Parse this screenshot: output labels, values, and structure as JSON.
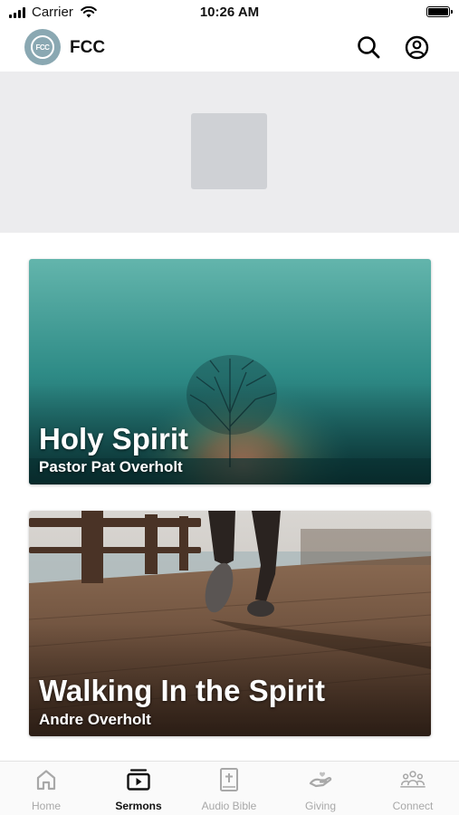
{
  "status_bar": {
    "carrier": "Carrier",
    "time": "10:26 AM"
  },
  "header": {
    "logo_text": "FCC",
    "title": "FCC",
    "icons": [
      "search-icon",
      "profile-icon"
    ]
  },
  "sermons": [
    {
      "title": "Holy Spirit",
      "speaker": "Pastor Pat Overholt"
    },
    {
      "title": "Walking In the Spirit",
      "speaker": "Andre Overholt"
    }
  ],
  "tabs": [
    {
      "label": "Home",
      "icon": "home-icon",
      "active": false
    },
    {
      "label": "Sermons",
      "icon": "sermons-icon",
      "active": true
    },
    {
      "label": "Audio Bible",
      "icon": "bible-icon",
      "active": false
    },
    {
      "label": "Giving",
      "icon": "giving-icon",
      "active": false
    },
    {
      "label": "Connect",
      "icon": "connect-icon",
      "active": false
    }
  ],
  "colors": {
    "accent": "#111111",
    "inactive_tab": "#a8a8a8",
    "hero_background": "#ececee"
  }
}
